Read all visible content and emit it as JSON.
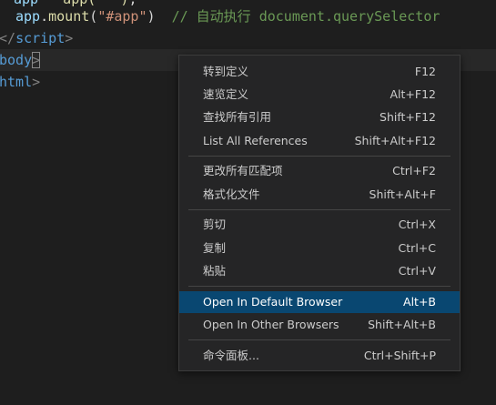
{
  "editor": {
    "line_top": {
      "part1": "app",
      "part2": "   app(   )",
      "part3": ";"
    },
    "line1": {
      "obj": "app",
      "dot": ".",
      "fn": "mount",
      "open": "(",
      "str": "\"#app\"",
      "close": ")",
      "space": "  ",
      "comment": "// 自动执行 document.querySelector"
    },
    "line2": {
      "open": "</",
      "tag": "script",
      "close": ">"
    },
    "line3": {
      "tag": "body",
      "close": ">"
    },
    "line4": {
      "tag": "html",
      "close": ">"
    }
  },
  "menu": {
    "groups": [
      [
        {
          "label": "转到定义",
          "shortcut": "F12"
        },
        {
          "label": "速览定义",
          "shortcut": "Alt+F12"
        },
        {
          "label": "查找所有引用",
          "shortcut": "Shift+F12"
        },
        {
          "label": "List All References",
          "shortcut": "Shift+Alt+F12"
        }
      ],
      [
        {
          "label": "更改所有匹配项",
          "shortcut": "Ctrl+F2"
        },
        {
          "label": "格式化文件",
          "shortcut": "Shift+Alt+F"
        }
      ],
      [
        {
          "label": "剪切",
          "shortcut": "Ctrl+X"
        },
        {
          "label": "复制",
          "shortcut": "Ctrl+C"
        },
        {
          "label": "粘贴",
          "shortcut": "Ctrl+V"
        }
      ],
      [
        {
          "label": "Open In Default Browser",
          "shortcut": "Alt+B",
          "highlighted": true
        },
        {
          "label": "Open In Other Browsers",
          "shortcut": "Shift+Alt+B"
        }
      ],
      [
        {
          "label": "命令面板...",
          "shortcut": "Ctrl+Shift+P"
        }
      ]
    ]
  },
  "colors": {
    "editor_background": "#1e1e1e",
    "menu_background": "#252526",
    "menu_highlight": "#094771",
    "menu_text": "#cccccc",
    "separator": "#454545",
    "tag": "#569cd6",
    "string": "#ce9178",
    "comment": "#6a9955",
    "function": "#dcdcaa",
    "variable": "#9cdcfe"
  }
}
